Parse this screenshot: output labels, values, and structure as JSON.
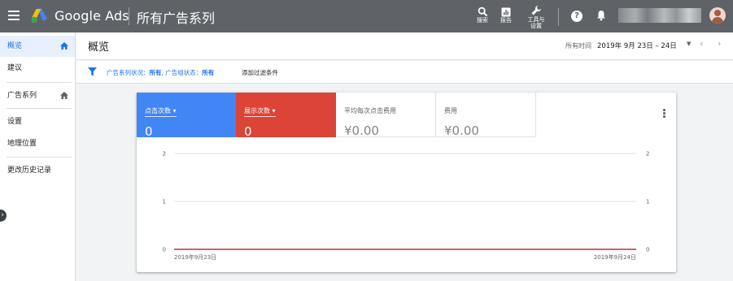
{
  "topbar": {
    "brand": "Google Ads",
    "section_title": "所有广告系列",
    "tools": [
      {
        "icon": "search-icon",
        "label": "搜索"
      },
      {
        "icon": "report-icon",
        "label": "报告"
      },
      {
        "icon": "wrench-icon",
        "label_line1": "工具与",
        "label_line2": "设置"
      }
    ],
    "help_glyph": "?"
  },
  "sidebar": {
    "items": [
      {
        "label": "概览",
        "active": true
      },
      {
        "label": "建议"
      },
      {
        "label": "广告系列"
      },
      {
        "label": "设置"
      },
      {
        "label": "地理位置"
      },
      {
        "label": "更改历史记录"
      }
    ]
  },
  "header": {
    "title": "概览",
    "date_label": "所有时间",
    "date_range": "2019年 9月 23日 – 24日"
  },
  "filter": {
    "campaign_status_label": "广告系列状况：",
    "campaign_status_value": "所有",
    "adgroup_status_label": ", 广告组状态：",
    "adgroup_status_value": "所有",
    "add_filter": "添加过滤条件"
  },
  "metrics": [
    {
      "label": "点击次数",
      "value": "0",
      "color": "#4285f4"
    },
    {
      "label": "展示次数",
      "value": "0",
      "color": "#db4437"
    },
    {
      "label": "平均每次点击费用",
      "value": "¥0.00"
    },
    {
      "label": "费用",
      "value": "¥0.00"
    }
  ],
  "chart_data": {
    "type": "line",
    "x": [
      "2019年9月23日",
      "2019年9月24日"
    ],
    "series": [
      {
        "name": "点击次数",
        "values": [
          0,
          0
        ],
        "color": "#4285f4"
      },
      {
        "name": "展示次数",
        "values": [
          0,
          0
        ],
        "color": "#db4437"
      }
    ],
    "yticks": [
      "0",
      "1",
      "2"
    ],
    "ylim": [
      0,
      2
    ],
    "grid": true,
    "dual_axis": true
  }
}
